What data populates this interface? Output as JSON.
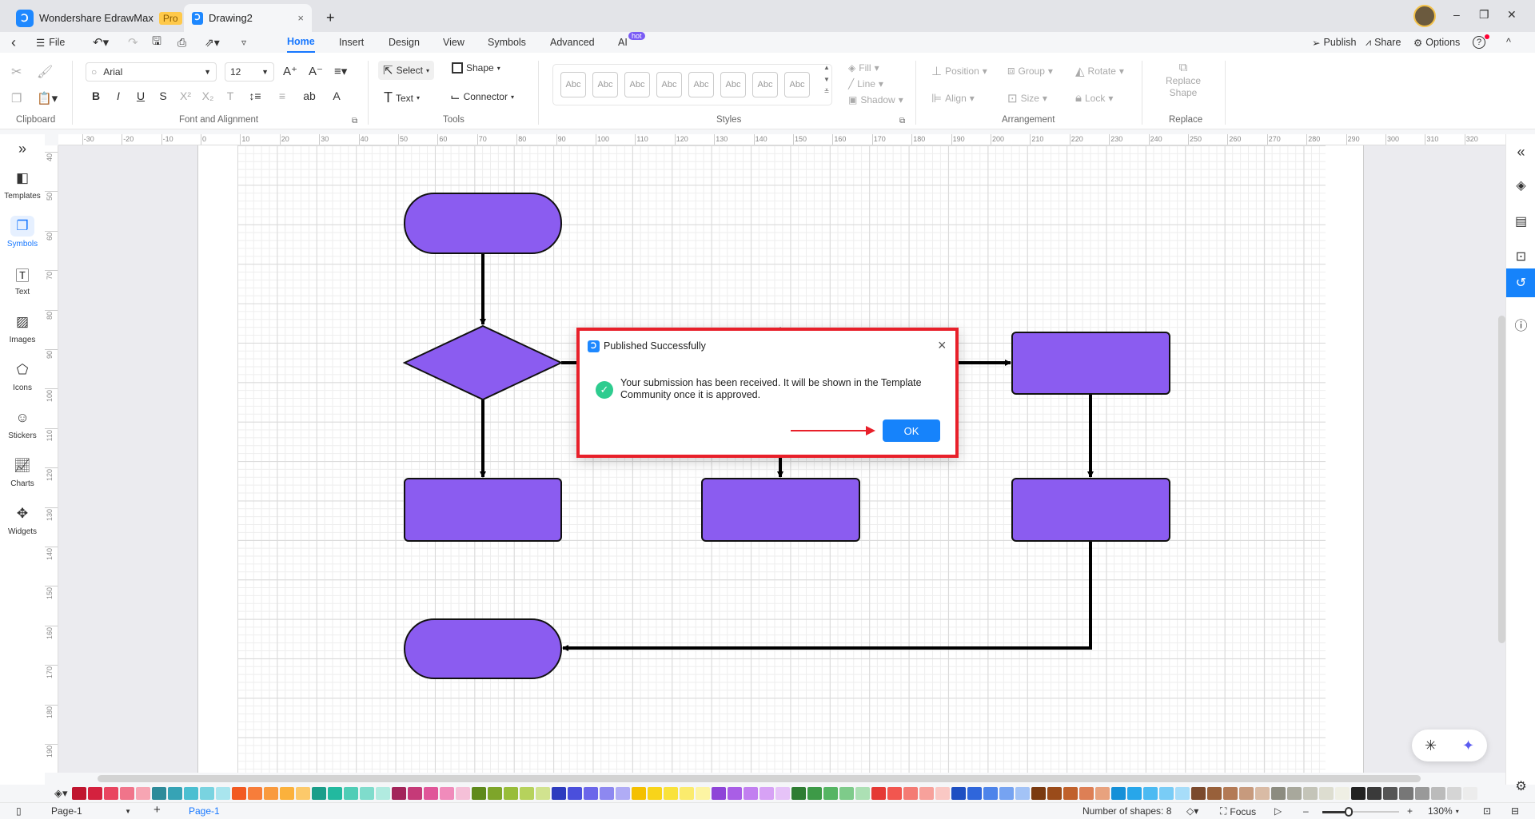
{
  "app": {
    "title": "Wondershare EdrawMax",
    "badge": "Pro",
    "doc_tab": "Drawing2",
    "close": "×",
    "new_tab": "+",
    "win_min": "–",
    "win_max": "❐",
    "win_close": "✕"
  },
  "menu": {
    "back": "‹",
    "file": "File",
    "tabs": [
      "Home",
      "Insert",
      "Design",
      "View",
      "Symbols",
      "Advanced",
      "AI"
    ],
    "ai_badge": "hot",
    "active": "Home",
    "publish": "Publish",
    "share": "Share",
    "options": "Options",
    "help": "?",
    "collapse": "^"
  },
  "ribbon": {
    "clipboard": "Clipboard",
    "font_group": "Font and Alignment",
    "tools_group": "Tools",
    "styles_group": "Styles",
    "arrangement_group": "Arrangement",
    "replace_group": "Replace",
    "font": "Arial",
    "size": "12",
    "select": "Select",
    "shape": "Shape",
    "text": "Text",
    "connector": "Connector",
    "style_swatch": "Abc",
    "fill": "Fill",
    "line": "Line",
    "shadow": "Shadow",
    "position": "Position",
    "group": "Group",
    "rotate": "Rotate",
    "align": "Align",
    "size_btn": "Size",
    "lock": "Lock",
    "replace_shape_1": "Replace",
    "replace_shape_2": "Shape",
    "format_buttons": [
      "B",
      "I",
      "U",
      "S",
      "X²",
      "X₂",
      "T",
      "↕≡",
      "≡",
      "ab",
      "A"
    ]
  },
  "sidebar": {
    "expand": "»",
    "items": [
      {
        "label": "Templates",
        "icon": "template-icon"
      },
      {
        "label": "Symbols",
        "icon": "symbols-icon",
        "active": true
      },
      {
        "label": "Text",
        "icon": "text-icon"
      },
      {
        "label": "Images",
        "icon": "image-icon"
      },
      {
        "label": "Icons",
        "icon": "icons-icon"
      },
      {
        "label": "Stickers",
        "icon": "sticker-icon"
      },
      {
        "label": "Charts",
        "icon": "chart-icon"
      },
      {
        "label": "Widgets",
        "icon": "widget-icon"
      }
    ]
  },
  "rightbar": {
    "collapse": "«",
    "items": [
      "fill-icon",
      "page-icon",
      "presentation-icon",
      "history-icon",
      "help-icon"
    ],
    "active": "history-icon"
  },
  "ruler": {
    "h": [
      "-30",
      "-20",
      "-10",
      "0",
      "10",
      "20",
      "30",
      "40",
      "50",
      "60",
      "70",
      "80",
      "90",
      "100",
      "110",
      "120",
      "130",
      "140",
      "150",
      "160",
      "170",
      "180",
      "190",
      "200",
      "210",
      "220",
      "230",
      "240",
      "250",
      "260",
      "270",
      "280",
      "290",
      "300",
      "310",
      "320"
    ],
    "v": [
      "40",
      "50",
      "60",
      "70",
      "80",
      "90",
      "100",
      "110",
      "120",
      "130",
      "140",
      "150",
      "160",
      "170",
      "180",
      "190"
    ]
  },
  "diagram": {
    "fill": "#8b5cf0",
    "stroke": "#111111"
  },
  "dialog": {
    "title": "Published Successfully",
    "message": "Your submission has been received. It will be shown in the Template Community once it is approved.",
    "ok": "OK",
    "highlight": "#e8202a",
    "accent": "#1683fb",
    "success": "#2ecc8f"
  },
  "palette": [
    "#c0152f",
    "#d4213e",
    "#e94560",
    "#f0748a",
    "#f7a5b3",
    "#2e8b9a",
    "#36a3b5",
    "#4bbfd1",
    "#79d3e0",
    "#a9e5ee",
    "#f25a22",
    "#f77d3a",
    "#f99a3e",
    "#fbb13c",
    "#fcc96a",
    "#1a9e8a",
    "#22b99f",
    "#4fcdb6",
    "#7fdccc",
    "#b1ebe0",
    "#a3245a",
    "#c53a78",
    "#e05599",
    "#f08bbb",
    "#f5c0d8",
    "#5f8a1c",
    "#7ea52a",
    "#98bd3a",
    "#b6d25c",
    "#d1e38f",
    "#2d3bbf",
    "#4a4fdc",
    "#6b66ea",
    "#8d88f0",
    "#b0acf5",
    "#f4c000",
    "#f8d41a",
    "#f9e23b",
    "#fbeb6d",
    "#fdf4a3",
    "#8e44d8",
    "#a95ee6",
    "#c27ff0",
    "#d7a2f5",
    "#e6c3f8",
    "#2e7d32",
    "#3d9a47",
    "#55b563",
    "#7ecb8a",
    "#ace0b4",
    "#e53935",
    "#f2564f",
    "#f47b74",
    "#f7a19b",
    "#fac8c4",
    "#1e4fc2",
    "#2f66db",
    "#4d84ea",
    "#76a3f1",
    "#a3c3f6",
    "#7a3a10",
    "#9a4b1a",
    "#c0612b",
    "#dd7f55",
    "#e8a27e",
    "#1590d8",
    "#27a6ea",
    "#4bbaf2",
    "#79ccf6",
    "#a7ddf9",
    "#7b4a2d",
    "#98603a",
    "#b37a55",
    "#c79a7d",
    "#d9bba5",
    "#8c8c80",
    "#a8a89c",
    "#c4c4b8",
    "#ddddd0",
    "#efefe4",
    "#222222",
    "#3a3a3a",
    "#555555",
    "#777777",
    "#999999",
    "#bbbbbb",
    "#d5d5d5",
    "#ececec"
  ],
  "status": {
    "page_selector": "Page-1",
    "add_page": "+",
    "page_tab": "Page-1",
    "shapes": "Number of shapes: 8",
    "focus": "Focus",
    "zoom_out": "–",
    "zoom_in": "+",
    "zoom": "130%",
    "zoom_level_percent": 130
  }
}
